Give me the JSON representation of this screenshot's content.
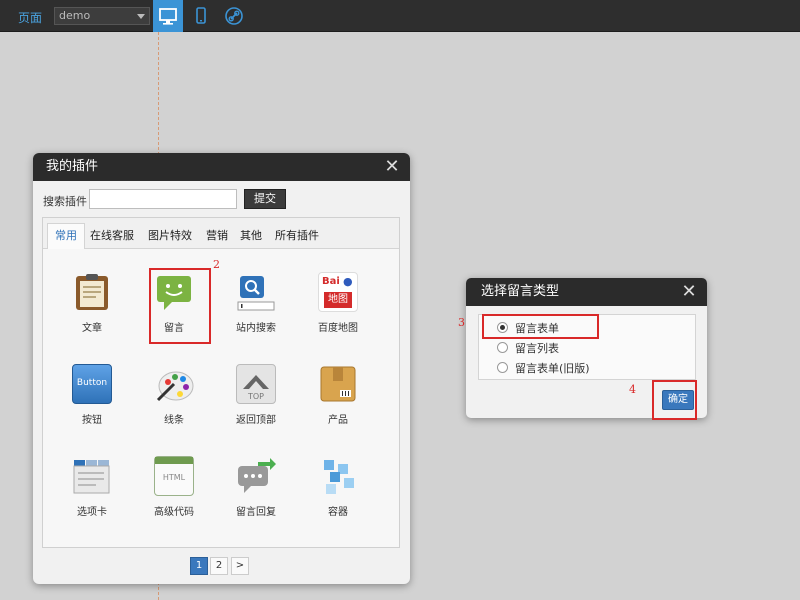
{
  "toolbar": {
    "page_label": "页面",
    "page_select": "demo",
    "buttons": [
      "desktop-icon",
      "phone-icon",
      "link-icon"
    ],
    "accent": "#3b94d6"
  },
  "plugins_panel": {
    "title": "我的插件",
    "search_label": "搜索插件",
    "search_value": "",
    "search_button": "提交",
    "tabs": [
      "常用",
      "在线客服",
      "图片特效",
      "营销",
      "其他",
      "所有插件"
    ],
    "active_tab": "常用",
    "items": [
      {
        "label": "文章",
        "icon": "clipboard-icon"
      },
      {
        "label": "留言",
        "icon": "message-bubble-icon"
      },
      {
        "label": "站内搜索",
        "icon": "site-search-icon"
      },
      {
        "label": "百度地图",
        "icon": "baidu-map-icon"
      },
      {
        "label": "按钮",
        "icon": "button-icon"
      },
      {
        "label": "线条",
        "icon": "palette-icon"
      },
      {
        "label": "返回顶部",
        "icon": "back-to-top-icon"
      },
      {
        "label": "产品",
        "icon": "product-box-icon"
      },
      {
        "label": "选项卡",
        "icon": "tabs-icon"
      },
      {
        "label": "高级代码",
        "icon": "html-code-icon"
      },
      {
        "label": "留言回复",
        "icon": "reply-bubble-icon"
      },
      {
        "label": "容器",
        "icon": "container-cubes-icon"
      }
    ],
    "baidu_text_1": "Bai",
    "baidu_text_2": "地图",
    "button_icon_text": "Button",
    "top_icon_text": "TOP",
    "html_icon_text": "HTML",
    "pages": [
      "1",
      "2"
    ],
    "current_page": "1",
    "next_label": ">"
  },
  "message_type_dialog": {
    "title": "选择留言类型",
    "options": [
      "留言表单",
      "留言列表",
      "留言表单(旧版)"
    ],
    "selected": "留言表单",
    "ok_button": "确定"
  },
  "annotations": {
    "step_2": "2",
    "step_3": "3",
    "step_4": "4",
    "color": "#d92929"
  }
}
